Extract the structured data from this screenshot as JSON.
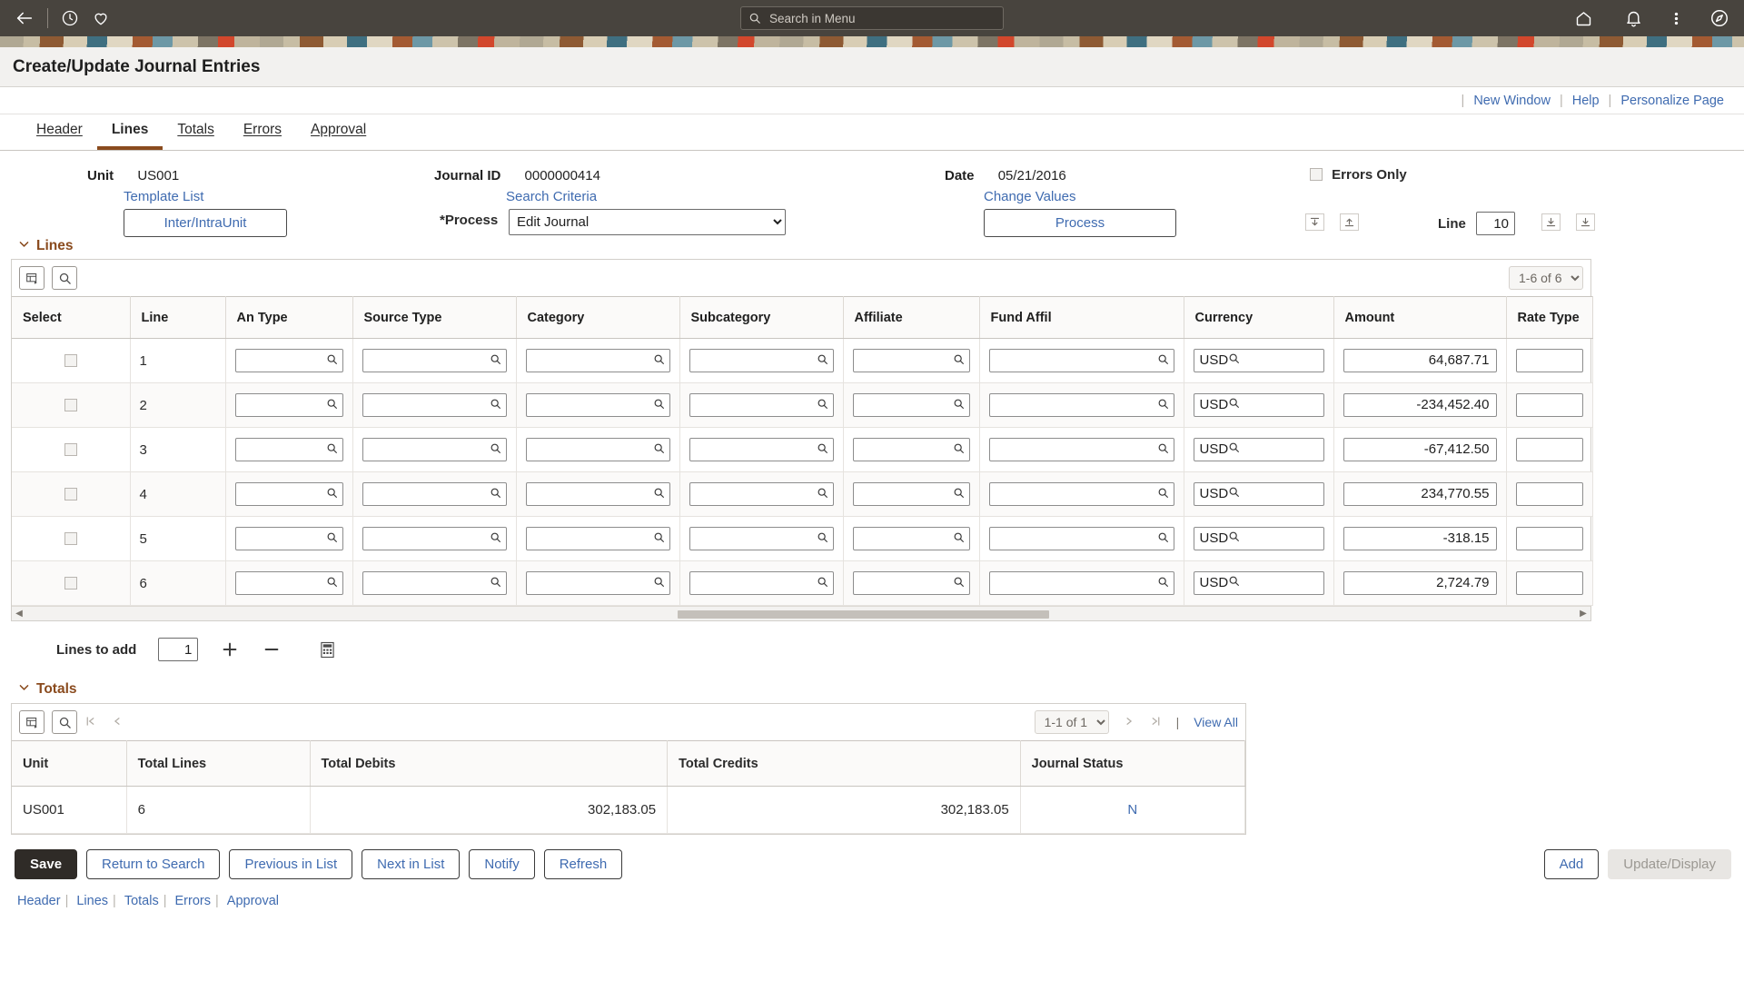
{
  "topbar": {
    "back_icon": "back-arrow-icon",
    "history_icon": "clock-icon",
    "favorites_icon": "heart-icon",
    "search_placeholder": "Search in Menu",
    "search_value": "",
    "home_icon": "home-icon",
    "notifications_icon": "bell-icon",
    "actions_icon": "kebab-menu-icon",
    "nav_icon": "compass-icon"
  },
  "page": {
    "title": "Create/Update Journal Entries"
  },
  "utility": {
    "new_window": "New Window",
    "help": "Help",
    "personalize": "Personalize Page",
    "separator": "|"
  },
  "tabs": [
    {
      "label": "Header",
      "active": false
    },
    {
      "label": "Lines",
      "active": true
    },
    {
      "label": "Totals",
      "active": false
    },
    {
      "label": "Errors",
      "active": false
    },
    {
      "label": "Approval",
      "active": false
    }
  ],
  "info": {
    "unit_label": "Unit",
    "unit_value": "US001",
    "template_list_link": "Template List",
    "inter_intra_button": "Inter/IntraUnit",
    "journal_id_label": "Journal ID",
    "journal_id_value": "0000000414",
    "search_criteria_link": "Search Criteria",
    "process_label": "*Process",
    "process_value": "Edit Journal",
    "process_options": [
      "Edit Journal"
    ],
    "date_label": "Date",
    "date_value": "05/21/2016",
    "change_values_link": "Change Values",
    "process_button": "Process",
    "errors_only_label": "Errors Only",
    "errors_only_checked": false,
    "line_label": "Line",
    "line_value": "10",
    "nav_first_icon": "first-line-icon",
    "nav_prev_icon": "previous-line-icon",
    "nav_next_icon": "next-line-icon",
    "nav_last_icon": "last-line-icon"
  },
  "lines_section": {
    "title": "Lines",
    "collapse_icon": "chevron-down-icon",
    "personalize_icon": "grid-personalize-icon",
    "find_icon": "search-icon",
    "pager_value": "1-6 of 6",
    "pager_options": [
      "1-6 of 6"
    ],
    "columns": [
      "Select",
      "Line",
      "An Type",
      "Source Type",
      "Category",
      "Subcategory",
      "Affiliate",
      "Fund Affil",
      "Currency",
      "Amount",
      "Rate Type"
    ],
    "rows": [
      {
        "select": false,
        "line": "1",
        "an_type": "",
        "source_type": "",
        "category": "",
        "subcategory": "",
        "affiliate": "",
        "fund_affil": "",
        "currency": "USD",
        "amount": "64,687.71",
        "rate_type": ""
      },
      {
        "select": false,
        "line": "2",
        "an_type": "",
        "source_type": "",
        "category": "",
        "subcategory": "",
        "affiliate": "",
        "fund_affil": "",
        "currency": "USD",
        "amount": "-234,452.40",
        "rate_type": ""
      },
      {
        "select": false,
        "line": "3",
        "an_type": "",
        "source_type": "",
        "category": "",
        "subcategory": "",
        "affiliate": "",
        "fund_affil": "",
        "currency": "USD",
        "amount": "-67,412.50",
        "rate_type": ""
      },
      {
        "select": false,
        "line": "4",
        "an_type": "",
        "source_type": "",
        "category": "",
        "subcategory": "",
        "affiliate": "",
        "fund_affil": "",
        "currency": "USD",
        "amount": "234,770.55",
        "rate_type": ""
      },
      {
        "select": false,
        "line": "5",
        "an_type": "",
        "source_type": "",
        "category": "",
        "subcategory": "",
        "affiliate": "",
        "fund_affil": "",
        "currency": "USD",
        "amount": "-318.15",
        "rate_type": ""
      },
      {
        "select": false,
        "line": "6",
        "an_type": "",
        "source_type": "",
        "category": "",
        "subcategory": "",
        "affiliate": "",
        "fund_affil": "",
        "currency": "USD",
        "amount": "2,724.79",
        "rate_type": ""
      }
    ]
  },
  "lines_add": {
    "label": "Lines to add",
    "value": "1",
    "add_icon": "plus-icon",
    "remove_icon": "minus-icon",
    "calc_icon": "calculator-icon"
  },
  "totals_section": {
    "title": "Totals",
    "collapse_icon": "chevron-down-icon",
    "personalize_icon": "grid-personalize-icon",
    "find_icon": "search-icon",
    "first_icon": "first-page-icon",
    "prev_icon": "previous-page-icon",
    "next_icon": "next-page-icon",
    "last_icon": "last-page-icon",
    "pager_value": "1-1 of 1",
    "pager_options": [
      "1-1 of 1"
    ],
    "view_all": "View All",
    "columns": [
      "Unit",
      "Total Lines",
      "Total Debits",
      "Total Credits",
      "Journal Status"
    ],
    "rows": [
      {
        "unit": "US001",
        "total_lines": "6",
        "total_debits": "302,183.05",
        "total_credits": "302,183.05",
        "journal_status": "N"
      }
    ]
  },
  "actions": {
    "save": "Save",
    "return_to_search": "Return to Search",
    "previous_in_list": "Previous in List",
    "next_in_list": "Next in List",
    "notify": "Notify",
    "refresh": "Refresh",
    "add": "Add",
    "update_display": "Update/Display"
  },
  "footer_links": [
    "Header",
    "Lines",
    "Totals",
    "Errors",
    "Approval"
  ],
  "colors": {
    "topbar_bg": "#48443e",
    "accent": "#8a4b1e",
    "link": "#3f6bb0",
    "save_bg": "#2f2b27"
  }
}
